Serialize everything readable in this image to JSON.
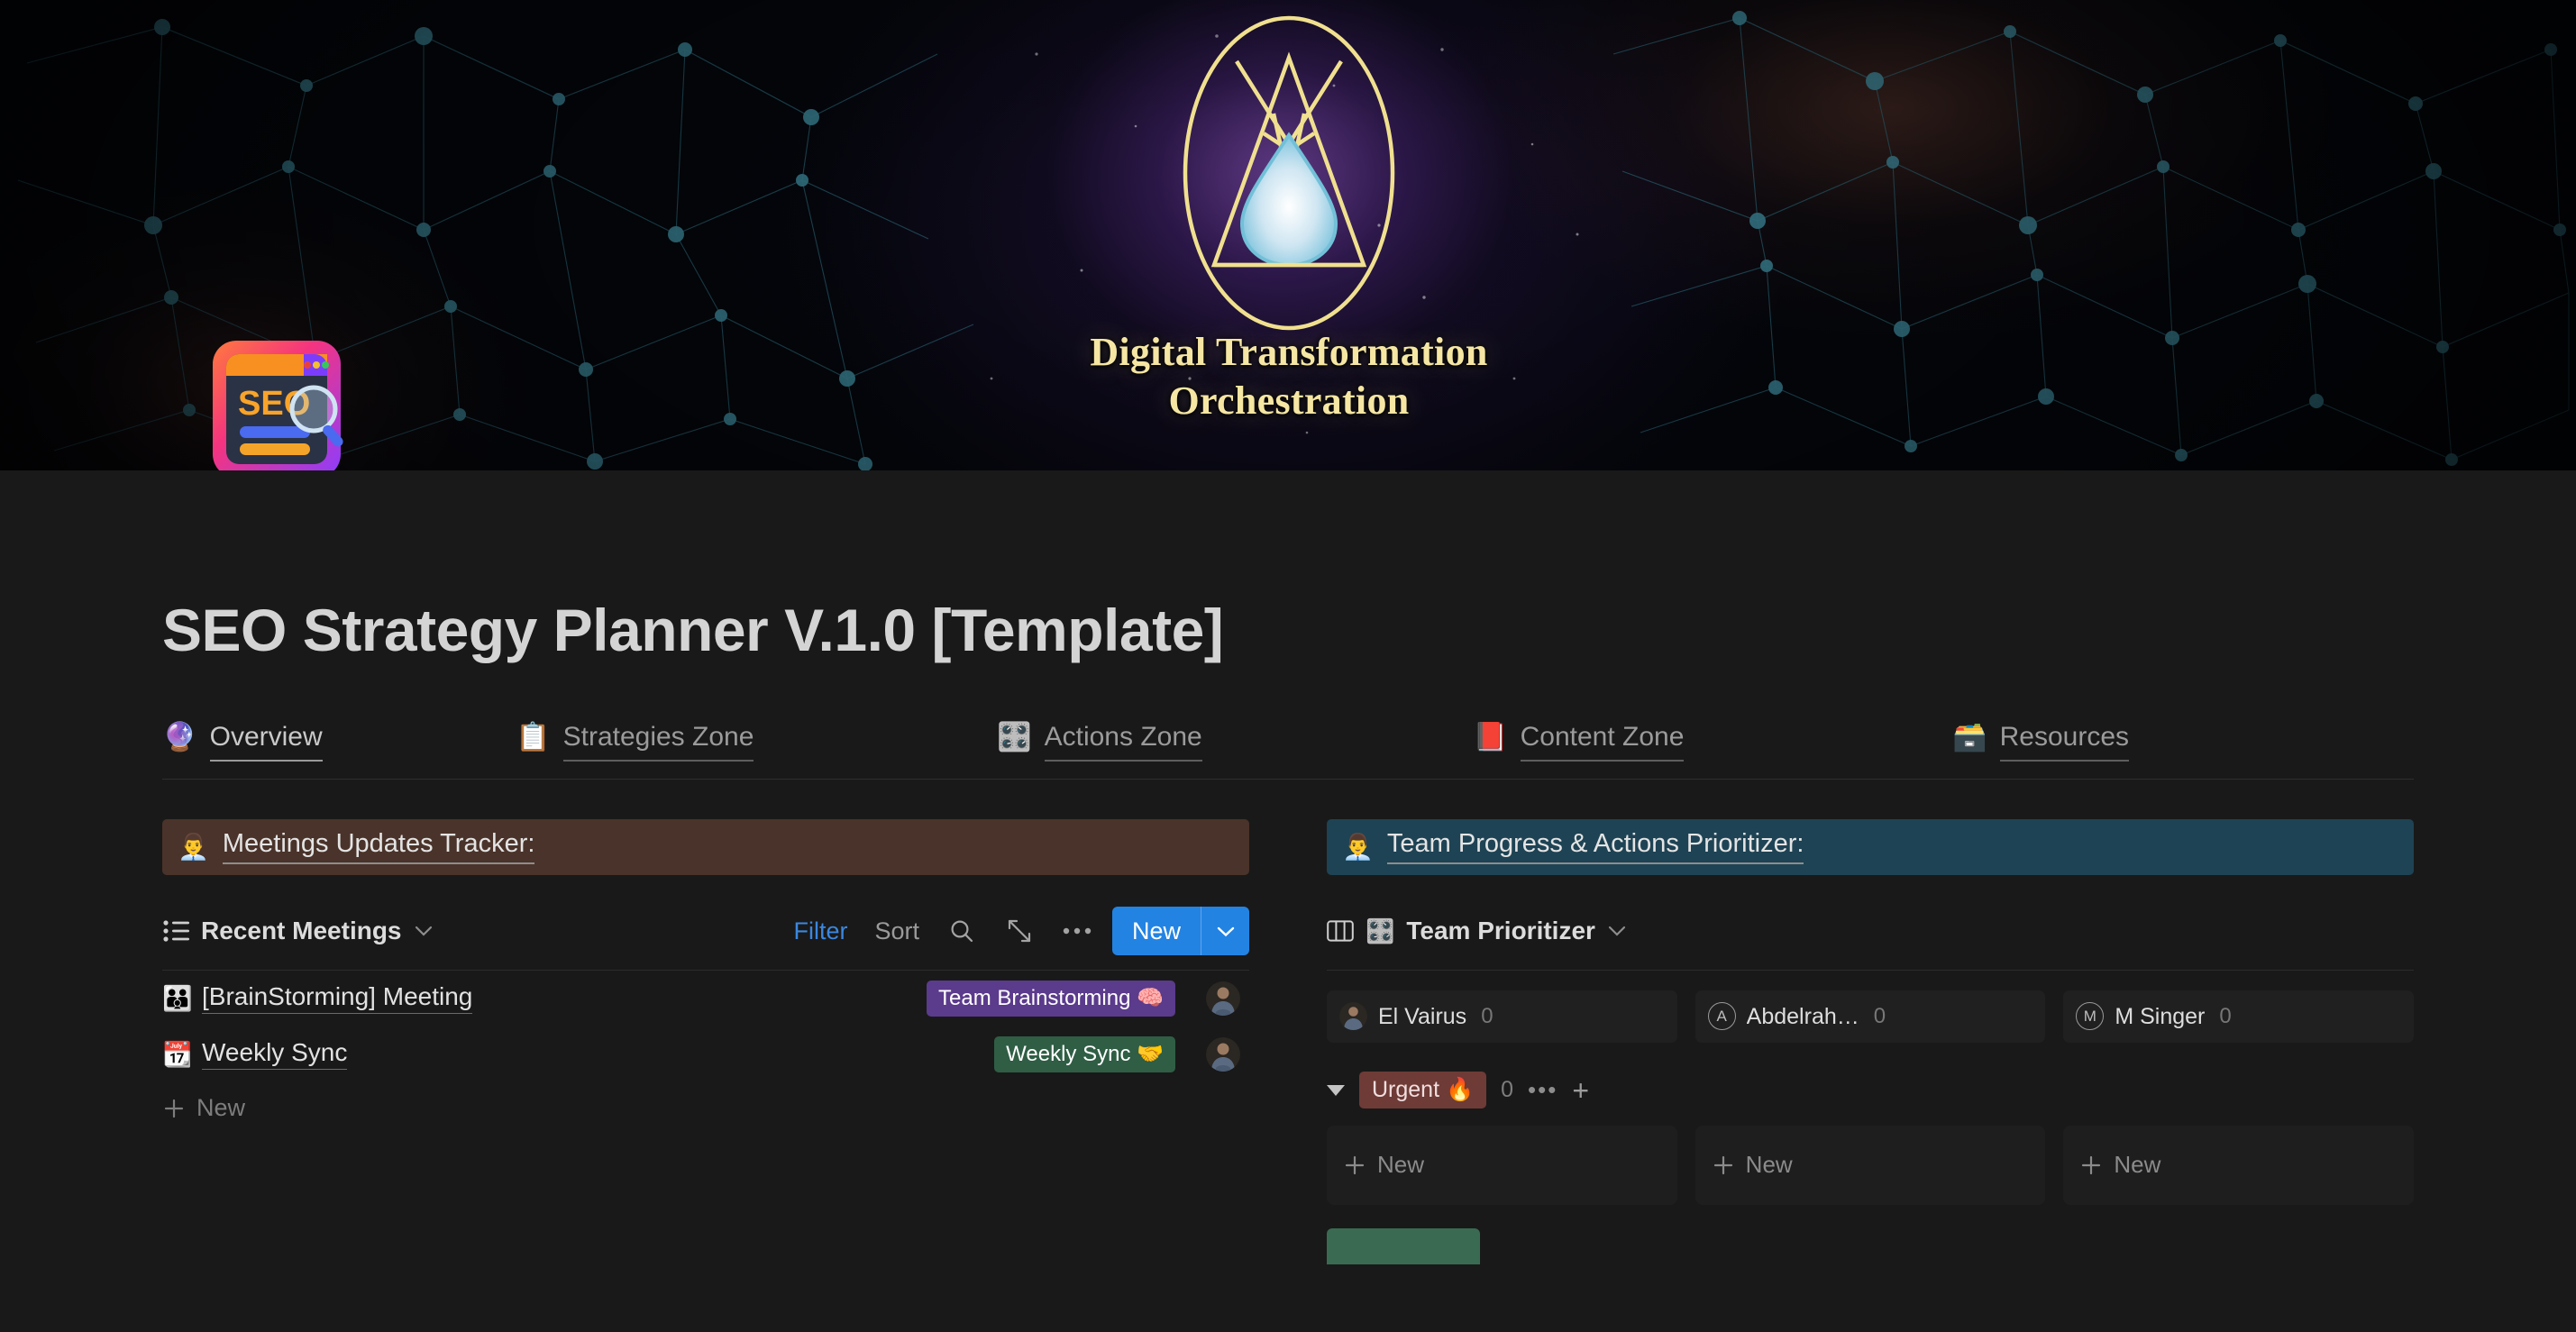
{
  "banner": {
    "emblem_title_line1": "Digital Transformation",
    "emblem_title_line2": "Orchestration",
    "emblem_icon": "alchemical-triangle-droplet-logo",
    "accent_gold": "#f5e6a3",
    "nebula_purple": "#8a4fc4"
  },
  "page": {
    "icon": "seo-monitor-3d-icon",
    "title": "SEO Strategy Planner V.1.0 [Template]"
  },
  "tabs": [
    {
      "emoji": "🔮",
      "icon_name": "crystal-ball-icon",
      "label": "Overview",
      "active": true
    },
    {
      "emoji": "📋",
      "icon_name": "easel-board-icon",
      "label": "Strategies Zone",
      "active": false
    },
    {
      "emoji": "🎛️",
      "icon_name": "actions-board-icon",
      "label": "Actions Zone",
      "active": false
    },
    {
      "emoji": "📕",
      "icon_name": "content-king-icon",
      "label": "Content Zone",
      "active": false
    },
    {
      "emoji": "🗃️",
      "icon_name": "server-rack-icon",
      "label": "Resources",
      "active": false
    }
  ],
  "left_panel": {
    "header": {
      "emoji": "👨‍💼",
      "icon_name": "meeting-table-icon",
      "text": "Meetings Updates Tracker:",
      "bg_color": "#4a332a"
    },
    "toolbar": {
      "view_icon": "list-view-icon",
      "view_name": "Recent Meetings",
      "filter_label": "Filter",
      "sort_label": "Sort",
      "search_icon": "search-icon",
      "expand_icon": "expand-arrows-icon",
      "more_icon": "more-options-icon",
      "new_label": "New",
      "new_caret_icon": "chevron-down-icon",
      "filter_color": "#3b87e0",
      "new_button_color": "#2383e2"
    },
    "rows": [
      {
        "emoji": "👪",
        "icon_name": "brainstorm-group-icon",
        "title": "[BrainStorming] Meeting",
        "tag": "Team Brainstorming 🧠",
        "tag_color": "#5b3b8c",
        "avatar": "photo-avatar"
      },
      {
        "emoji": "📆",
        "icon_name": "calendar-pen-icon",
        "title": "Weekly Sync",
        "tag": "Weekly Sync 🤝",
        "tag_color": "#2f5e45",
        "avatar": "photo-avatar"
      }
    ],
    "new_row_label": "New"
  },
  "right_panel": {
    "header": {
      "emoji": "👨‍💼",
      "icon_name": "businessman-chart-icon",
      "text": "Team Progress & Actions Prioritizer:",
      "bg_color": "#1e4354"
    },
    "toolbar": {
      "view_icon": "board-view-icon",
      "view_emoji": "🎛️",
      "view_emoji_name": "red-alarm-icon",
      "view_name": "Team Prioritizer",
      "caret_icon": "chevron-down-icon"
    },
    "groups": [
      {
        "avatar_type": "photo",
        "initial": "",
        "name": "El Vairus",
        "count": "0"
      },
      {
        "avatar_type": "letter",
        "initial": "A",
        "name": "Abdelrah…",
        "count": "0"
      },
      {
        "avatar_type": "letter",
        "initial": "M",
        "name": "M Singer",
        "count": "0"
      }
    ],
    "status_row": {
      "collapse_icon": "caret-down-icon",
      "label": "Urgent 🔥",
      "label_color": "#6e3b36",
      "count": "0",
      "more_icon": "more-options-icon",
      "add_icon": "plus-icon"
    },
    "card_new_label": "New",
    "next_group_color": "#3a6b52"
  }
}
